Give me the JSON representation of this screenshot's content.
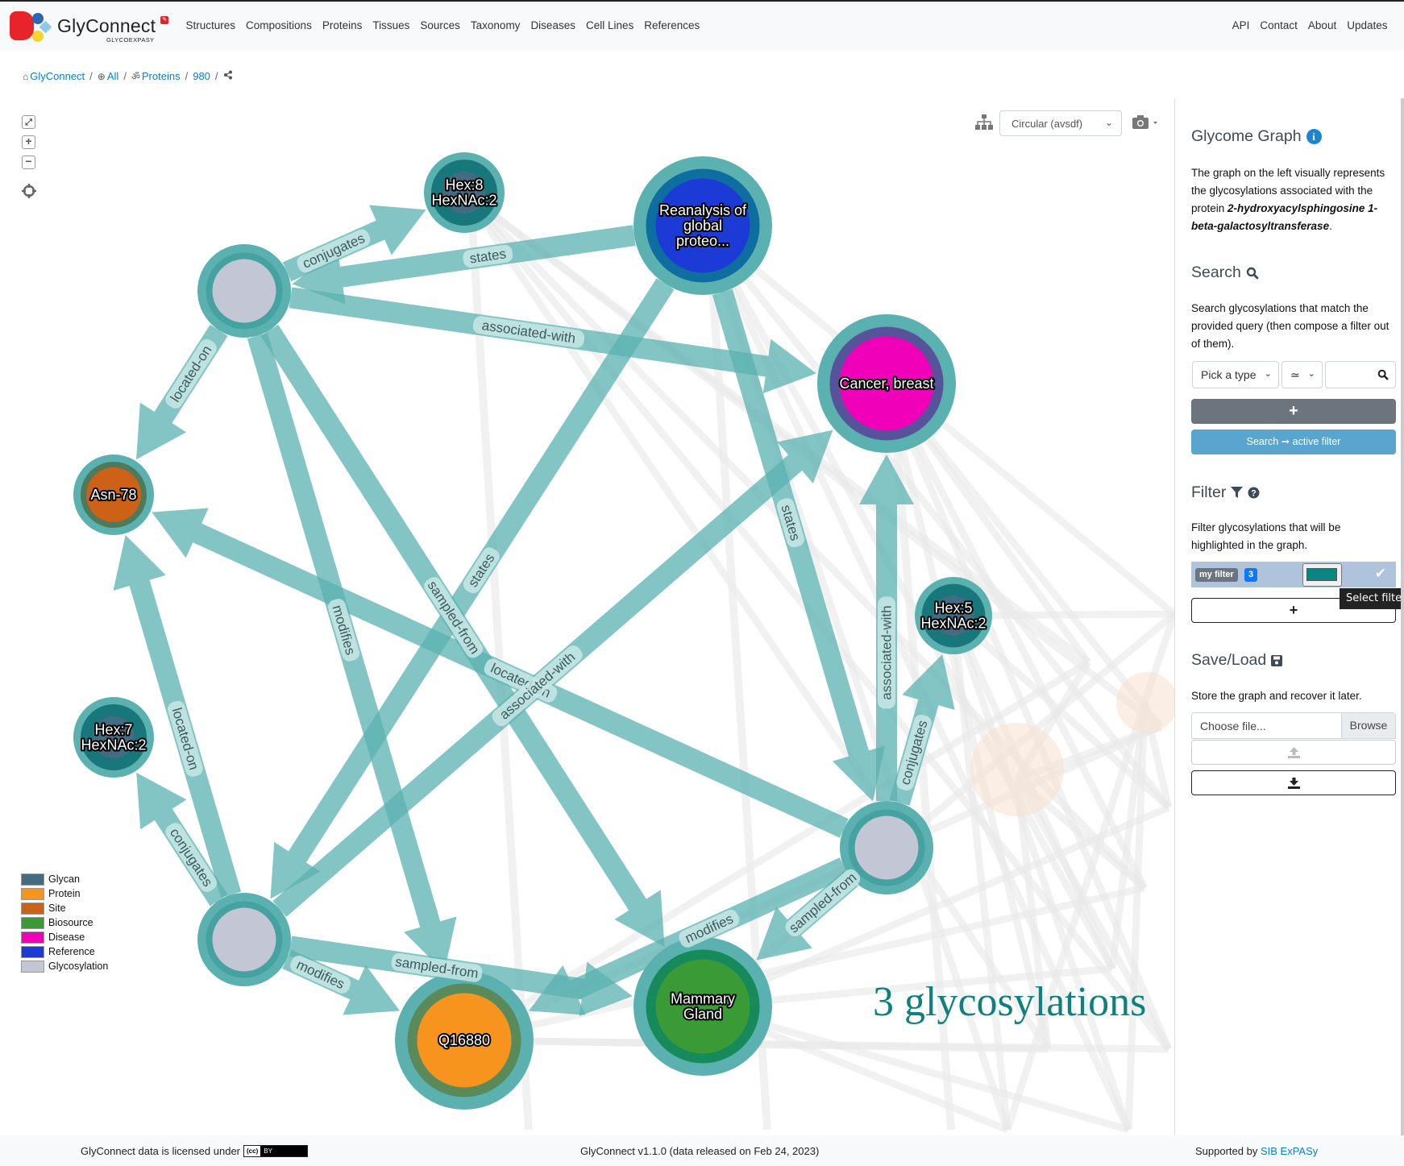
{
  "navbar": {
    "brand": "GlyConnect",
    "brand_sub": "GLYCOEXPASY",
    "brand_badge": "✎",
    "left_items": [
      "Structures",
      "Compositions",
      "Proteins",
      "Tissues",
      "Sources",
      "Taxonomy",
      "Diseases",
      "Cell Lines",
      "References"
    ],
    "right_items": [
      "API",
      "Contact",
      "About",
      "Updates"
    ]
  },
  "breadcrumb": [
    {
      "icon": "home-icon",
      "glyph": "⌂",
      "label": "GlyConnect"
    },
    {
      "icon": "globe-icon",
      "glyph": "⊕",
      "label": "All"
    },
    {
      "icon": "om-icon",
      "glyph": "ॐ",
      "label": "Proteins"
    },
    {
      "icon": "",
      "glyph": "",
      "label": "980"
    },
    {
      "icon": "share-icon",
      "glyph": "⋖",
      "label": ""
    }
  ],
  "graph_toolbar": {
    "layout_value": "Circular (avsdf)",
    "fit_glyph": "⤢",
    "zoom_in_glyph": "+",
    "zoom_out_glyph": "−",
    "chevron": "⌄",
    "caret": "▾"
  },
  "legend": [
    {
      "label": "Glycan",
      "color": "#436b82"
    },
    {
      "label": "Protein",
      "color": "#f7941d"
    },
    {
      "label": "Site",
      "color": "#cd6118"
    },
    {
      "label": "Biosource",
      "color": "#3a9a35"
    },
    {
      "label": "Disease",
      "color": "#f000b8"
    },
    {
      "label": "Reference",
      "color": "#1c3bd6"
    },
    {
      "label": "Glycosylation",
      "color": "#c3c7d5"
    }
  ],
  "graph": {
    "highlight_color": "#5ab1b0",
    "nodes": [
      {
        "id": "gA",
        "type": "Glycosylation",
        "label": [],
        "fill": "#c3c7d5",
        "ring": "#46a2a1"
      },
      {
        "id": "hex8",
        "type": "Glycan",
        "label": [
          "Hex:8",
          "HexNAc:2"
        ],
        "fill": "#436b82",
        "ring": "#18777b"
      },
      {
        "id": "ref",
        "type": "Reference",
        "label": [
          "Reanalysis of",
          "global",
          "proteo..."
        ],
        "fill": "#1c3bd6",
        "ring": "#0f6ea0"
      },
      {
        "id": "cancer",
        "type": "Disease",
        "label": [
          "Cancer, breast"
        ],
        "fill": "#f000b8",
        "ring": "#56539a"
      },
      {
        "id": "asn78",
        "type": "Site",
        "label": [
          "Asn-78"
        ],
        "fill": "#cd6118",
        "ring": "#4c7a5a"
      },
      {
        "id": "hex5",
        "type": "Glycan",
        "label": [
          "Hex:5",
          "HexNAc:2"
        ],
        "fill": "#436b82",
        "ring": "#18777b"
      },
      {
        "id": "hex7",
        "type": "Glycan",
        "label": [
          "Hex:7",
          "HexNAc:2"
        ],
        "fill": "#436b82",
        "ring": "#18777b"
      },
      {
        "id": "gB",
        "type": "Glycosylation",
        "label": [],
        "fill": "#c3c7d5",
        "ring": "#46a2a1"
      },
      {
        "id": "gC",
        "type": "Glycosylation",
        "label": [],
        "fill": "#c3c7d5",
        "ring": "#46a2a1"
      },
      {
        "id": "q16880",
        "type": "Protein",
        "label": [
          "Q16880"
        ],
        "fill": "#f7941d",
        "ring": "#5b8a5a"
      },
      {
        "id": "mammary",
        "type": "Biosource",
        "label": [
          "Mammary",
          "Gland"
        ],
        "fill": "#3a9a35",
        "ring": "#178a5c"
      }
    ],
    "edges": [
      {
        "from": "gA",
        "to": "hex8",
        "label": "conjugates"
      },
      {
        "from": "ref",
        "to": "gA",
        "label": "states"
      },
      {
        "from": "gA",
        "to": "cancer",
        "label": "associated-with"
      },
      {
        "from": "gA",
        "to": "asn78",
        "label": "located-on"
      },
      {
        "from": "gA",
        "to": "q16880",
        "label": "modifies"
      },
      {
        "from": "gA",
        "to": "mammary",
        "label": "sampled-from"
      },
      {
        "from": "ref",
        "to": "gC",
        "label": "states"
      },
      {
        "from": "ref",
        "to": "gB",
        "label": "states"
      },
      {
        "from": "gB",
        "to": "cancer",
        "label": "associated-with"
      },
      {
        "from": "gB",
        "to": "hex5",
        "label": "conjugates"
      },
      {
        "from": "gB",
        "to": "asn78",
        "label": "located-on"
      },
      {
        "from": "gB",
        "to": "mammary",
        "label": "sampled-from"
      },
      {
        "from": "gB",
        "to": "q16880",
        "label": "modifies"
      },
      {
        "from": "gC",
        "to": "cancer",
        "label": "associated-with"
      },
      {
        "from": "gC",
        "to": "asn78",
        "label": "located-on"
      },
      {
        "from": "gC",
        "to": "hex7",
        "label": "conjugates"
      },
      {
        "from": "gC",
        "to": "q16880",
        "label": "modifies"
      },
      {
        "from": "gC",
        "to": "mammary",
        "label": "sampled-from"
      }
    ]
  },
  "glyco_count_text": "3 glycosylations",
  "panel": {
    "glycome_title": "Glycome Graph",
    "glycome_desc_pre": "The graph on the left visually represents the glycosylations associated with the protein ",
    "glycome_desc_protein": "2-hydroxyacylsphingosine 1-beta-galactosyltransferase",
    "glycome_desc_post": ".",
    "search_title": "Search",
    "search_desc": "Search glycosylations that match the provided query (then compose a filter out of them).",
    "type_select": "Pick a type",
    "op_select": "≃",
    "query_value": "",
    "add_glyph": "+",
    "search_active_label": "Search ➞ active filter",
    "filter_title": "Filter",
    "filter_desc": "Filter glycosylations that will be highlighted in the graph.",
    "filter_name": "my filter",
    "filter_count": "3",
    "filter_color": "#0b8582",
    "filter_check": "✔",
    "tooltip": "Select filter",
    "saveload_title": "Save/Load",
    "saveload_desc": "Store the graph and recover it later.",
    "file_placeholder": "Choose file...",
    "browse_label": "Browse",
    "upload_glyph": "⇪",
    "download_glyph": "⤓"
  },
  "footer": {
    "license_text": "GlyConnect data is licensed under",
    "cc_left": "(cc)",
    "cc_right": "BY",
    "version_text": "GlyConnect v1.1.0 (data released on Feb 24, 2023)",
    "supported_text": "Supported by",
    "supported_link": "SIB ExPASy"
  }
}
